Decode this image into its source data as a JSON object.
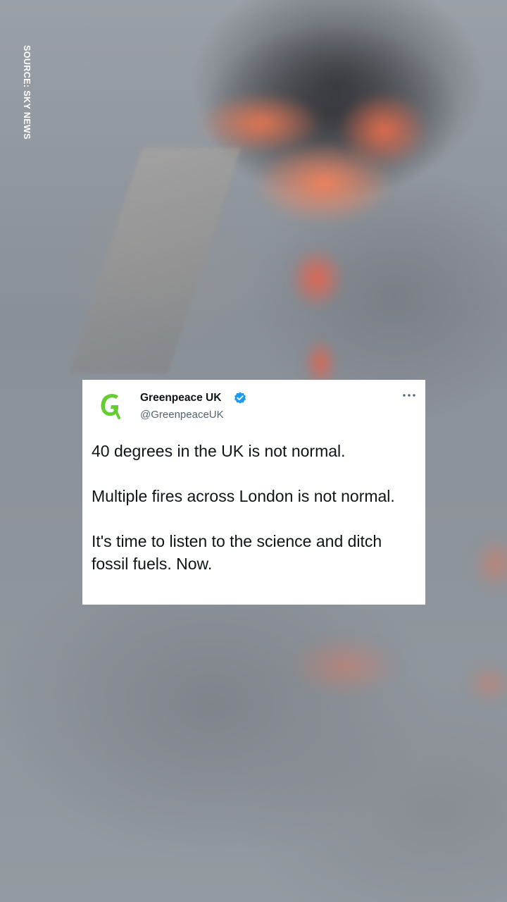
{
  "background": {
    "source_label": "SOURCE: SKY NEWS"
  },
  "tweet": {
    "avatar_icon": "greenpeace-g-logo-icon",
    "account_name": "Greenpeace UK",
    "verified_icon": "verified-badge-icon",
    "handle": "@GreenpeaceUK",
    "more_icon": "more-options-icon",
    "paragraphs": [
      "40 degrees in the UK is not normal.",
      "Multiple fires across London is not normal.",
      "It's time to listen to the science and ditch fossil fuels. Now."
    ]
  },
  "colors": {
    "brand_green": "#66cc33",
    "verified_blue": "#1d9bf0",
    "text_primary": "#0f1419",
    "text_secondary": "#536471",
    "card_background": "#ffffff"
  }
}
